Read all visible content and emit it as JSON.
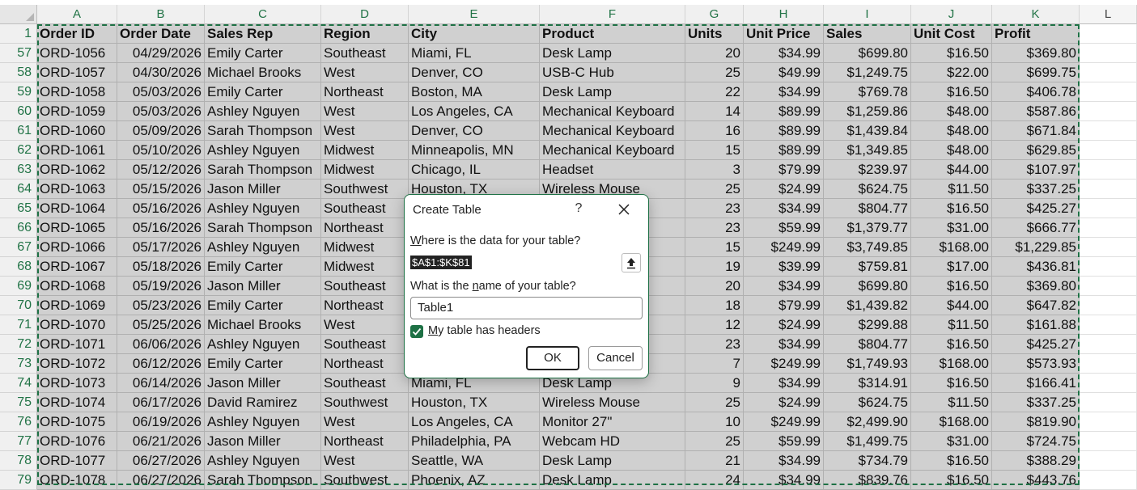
{
  "columns": [
    "A",
    "B",
    "C",
    "D",
    "E",
    "F",
    "G",
    "H",
    "I",
    "J",
    "K",
    "L"
  ],
  "header_row": {
    "row_number": "1",
    "cells": [
      "Order ID",
      "Order Date",
      "Sales Rep",
      "Region",
      "City",
      "Product",
      "Units",
      "Unit Price",
      "Sales",
      "Unit Cost",
      "Profit"
    ]
  },
  "rows": [
    {
      "n": "57",
      "c": [
        "ORD-1056",
        "04/29/2026",
        "Emily Carter",
        "Southeast",
        "Miami, FL",
        "Desk Lamp",
        "20",
        "$34.99",
        "$699.80",
        "$16.50",
        "$369.80"
      ]
    },
    {
      "n": "58",
      "c": [
        "ORD-1057",
        "04/30/2026",
        "Michael Brooks",
        "West",
        "Denver, CO",
        "USB-C Hub",
        "25",
        "$49.99",
        "$1,249.75",
        "$22.00",
        "$699.75"
      ]
    },
    {
      "n": "59",
      "c": [
        "ORD-1058",
        "05/03/2026",
        "Emily Carter",
        "Northeast",
        "Boston, MA",
        "Desk Lamp",
        "22",
        "$34.99",
        "$769.78",
        "$16.50",
        "$406.78"
      ]
    },
    {
      "n": "60",
      "c": [
        "ORD-1059",
        "05/03/2026",
        "Ashley Nguyen",
        "West",
        "Los Angeles, CA",
        "Mechanical Keyboard",
        "14",
        "$89.99",
        "$1,259.86",
        "$48.00",
        "$587.86"
      ]
    },
    {
      "n": "61",
      "c": [
        "ORD-1060",
        "05/09/2026",
        "Sarah Thompson",
        "West",
        "Denver, CO",
        "Mechanical Keyboard",
        "16",
        "$89.99",
        "$1,439.84",
        "$48.00",
        "$671.84"
      ]
    },
    {
      "n": "62",
      "c": [
        "ORD-1061",
        "05/10/2026",
        "Ashley Nguyen",
        "Midwest",
        "Minneapolis, MN",
        "Mechanical Keyboard",
        "15",
        "$89.99",
        "$1,349.85",
        "$48.00",
        "$629.85"
      ]
    },
    {
      "n": "63",
      "c": [
        "ORD-1062",
        "05/12/2026",
        "Sarah Thompson",
        "Midwest",
        "Chicago, IL",
        "Headset",
        "3",
        "$79.99",
        "$239.97",
        "$44.00",
        "$107.97"
      ]
    },
    {
      "n": "64",
      "c": [
        "ORD-1063",
        "05/15/2026",
        "Jason Miller",
        "Southwest",
        "Houston, TX",
        "Wireless Mouse",
        "25",
        "$24.99",
        "$624.75",
        "$11.50",
        "$337.25"
      ]
    },
    {
      "n": "65",
      "c": [
        "ORD-1064",
        "05/16/2026",
        "Ashley Nguyen",
        "Southeast",
        "",
        "",
        "23",
        "$34.99",
        "$804.77",
        "$16.50",
        "$425.27"
      ]
    },
    {
      "n": "66",
      "c": [
        "ORD-1065",
        "05/16/2026",
        "Sarah Thompson",
        "Northeast",
        "",
        "",
        "23",
        "$59.99",
        "$1,379.77",
        "$31.00",
        "$666.77"
      ]
    },
    {
      "n": "67",
      "c": [
        "ORD-1066",
        "05/17/2026",
        "Ashley Nguyen",
        "Midwest",
        "",
        "",
        "15",
        "$249.99",
        "$3,749.85",
        "$168.00",
        "$1,229.85"
      ]
    },
    {
      "n": "68",
      "c": [
        "ORD-1067",
        "05/18/2026",
        "Emily Carter",
        "Midwest",
        "",
        "",
        "19",
        "$39.99",
        "$759.81",
        "$17.00",
        "$436.81"
      ]
    },
    {
      "n": "69",
      "c": [
        "ORD-1068",
        "05/19/2026",
        "Jason Miller",
        "Southeast",
        "",
        "",
        "20",
        "$34.99",
        "$699.80",
        "$16.50",
        "$369.80"
      ]
    },
    {
      "n": "70",
      "c": [
        "ORD-1069",
        "05/23/2026",
        "Emily Carter",
        "Northeast",
        "",
        "",
        "18",
        "$79.99",
        "$1,439.82",
        "$44.00",
        "$647.82"
      ]
    },
    {
      "n": "71",
      "c": [
        "ORD-1070",
        "05/25/2026",
        "Michael Brooks",
        "West",
        "",
        "",
        "12",
        "$24.99",
        "$299.88",
        "$11.50",
        "$161.88"
      ]
    },
    {
      "n": "72",
      "c": [
        "ORD-1071",
        "06/06/2026",
        "Ashley Nguyen",
        "Southeast",
        "",
        "",
        "23",
        "$34.99",
        "$804.77",
        "$16.50",
        "$425.27"
      ]
    },
    {
      "n": "73",
      "c": [
        "ORD-1072",
        "06/12/2026",
        "Emily Carter",
        "Northeast",
        "",
        "",
        "7",
        "$249.99",
        "$1,749.93",
        "$168.00",
        "$573.93"
      ]
    },
    {
      "n": "74",
      "c": [
        "ORD-1073",
        "06/14/2026",
        "Jason Miller",
        "Southeast",
        "Miami, FL",
        "Desk Lamp",
        "9",
        "$34.99",
        "$314.91",
        "$16.50",
        "$166.41"
      ]
    },
    {
      "n": "75",
      "c": [
        "ORD-1074",
        "06/17/2026",
        "David Ramirez",
        "Southwest",
        "Houston, TX",
        "Wireless Mouse",
        "25",
        "$24.99",
        "$624.75",
        "$11.50",
        "$337.25"
      ]
    },
    {
      "n": "76",
      "c": [
        "ORD-1075",
        "06/19/2026",
        "Ashley Nguyen",
        "West",
        "Los Angeles, CA",
        "Monitor 27\"",
        "10",
        "$249.99",
        "$2,499.90",
        "$168.00",
        "$819.90"
      ]
    },
    {
      "n": "77",
      "c": [
        "ORD-1076",
        "06/21/2026",
        "Jason Miller",
        "Northeast",
        "Philadelphia, PA",
        "Webcam HD",
        "25",
        "$59.99",
        "$1,499.75",
        "$31.00",
        "$724.75"
      ]
    },
    {
      "n": "78",
      "c": [
        "ORD-1077",
        "06/27/2026",
        "Ashley Nguyen",
        "West",
        "Seattle, WA",
        "Desk Lamp",
        "21",
        "$34.99",
        "$734.79",
        "$16.50",
        "$388.29"
      ]
    },
    {
      "n": "79",
      "c": [
        "ORD-1078",
        "06/27/2026",
        "Sarah Thompson",
        "Southwest",
        "Phoenix, AZ",
        "Desk Lamp",
        "24",
        "$34.99",
        "$839.76",
        "$16.50",
        "$443.76"
      ]
    }
  ],
  "dialog": {
    "title": "Create Table",
    "help": "?",
    "range_label_pre": "",
    "range_label_u": "W",
    "range_label_post": "here is the data for your table?",
    "range_value": "$A$1:$K$81",
    "name_label_pre": "What is the ",
    "name_label_u": "n",
    "name_label_post": "ame of your table?",
    "name_value": "Table1",
    "headers_label_u": "M",
    "headers_label_post": "y table has headers",
    "headers_checked": true,
    "ok_label": "OK",
    "cancel_label": "Cancel"
  },
  "colors": {
    "accent": "#1e7145",
    "selection_fill": "#d0d0d0",
    "header_text": "#217346"
  }
}
